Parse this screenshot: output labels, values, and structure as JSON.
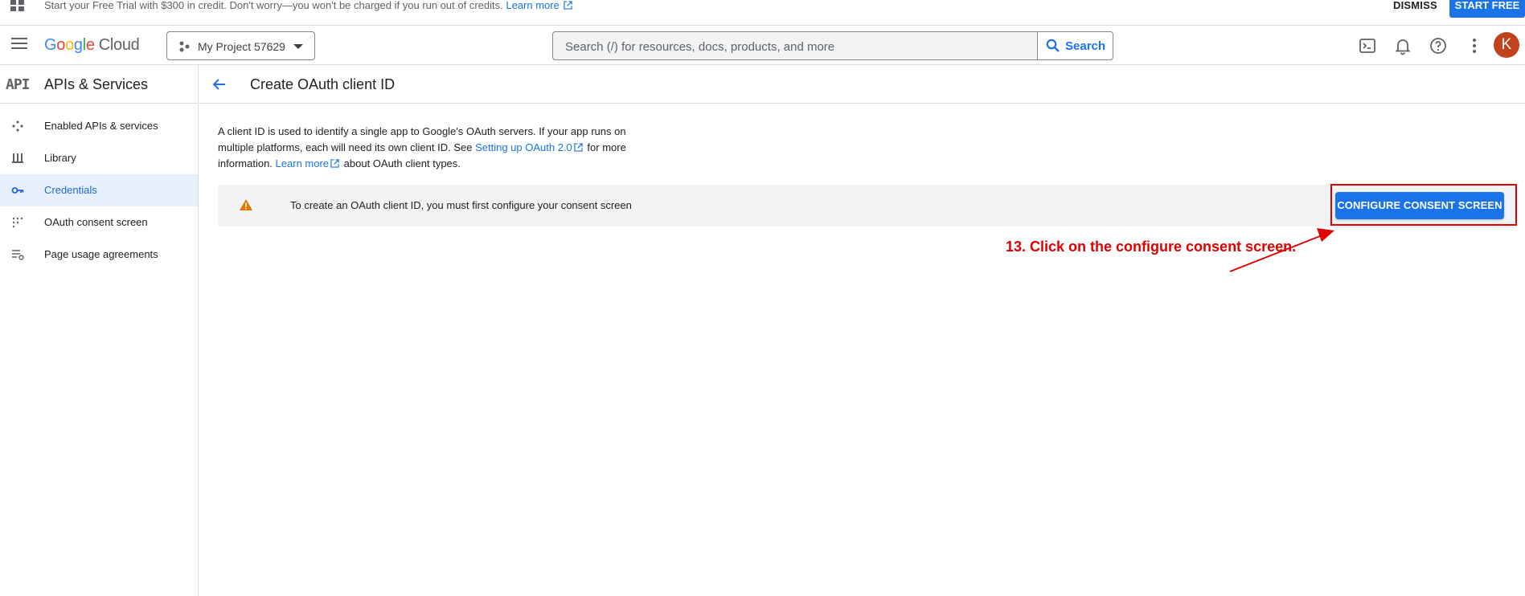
{
  "banner": {
    "message": "Start your Free Trial with $300 in credit. Don't worry—you won't be charged if you run out of credits.",
    "learn_more": "Learn more",
    "dismiss": "DISMISS",
    "start_free": "START FREE"
  },
  "header": {
    "logo_google": [
      "G",
      "o",
      "o",
      "g",
      "l",
      "e"
    ],
    "logo_cloud": "Cloud",
    "project_name": "My Project 57629",
    "search_placeholder": "Search (/) for resources, docs, products, and more",
    "search_button": "Search",
    "avatar_initial": "K"
  },
  "sidebar": {
    "api_badge": "API",
    "title": "APIs & Services",
    "items": [
      {
        "label": "Enabled APIs & services",
        "icon": "apis-icon",
        "active": false
      },
      {
        "label": "Library",
        "icon": "library-icon",
        "active": false
      },
      {
        "label": "Credentials",
        "icon": "key-icon",
        "active": true
      },
      {
        "label": "OAuth consent screen",
        "icon": "consent-icon",
        "active": false
      },
      {
        "label": "Page usage agreements",
        "icon": "agreements-icon",
        "active": false
      }
    ]
  },
  "main": {
    "title": "Create OAuth client ID",
    "desc_part1": "A client ID is used to identify a single app to Google's OAuth servers. If your app runs on multiple platforms, each will need its own client ID. See ",
    "desc_link1": "Setting up OAuth 2.0",
    "desc_part2": " for more information. ",
    "desc_link2": "Learn more",
    "desc_part3": " about OAuth client types.",
    "alert_message": "To create an OAuth client ID, you must first configure your consent screen",
    "configure_button": "CONFIGURE CONSENT SCREEN"
  },
  "annotation": {
    "text": "13. Click on the configure consent screen.",
    "color": "#e00000"
  },
  "colors": {
    "accent": "#1a73e8",
    "active_bg": "#e8f0fe",
    "avatar": "#c1421d",
    "warning": "#e37400"
  }
}
